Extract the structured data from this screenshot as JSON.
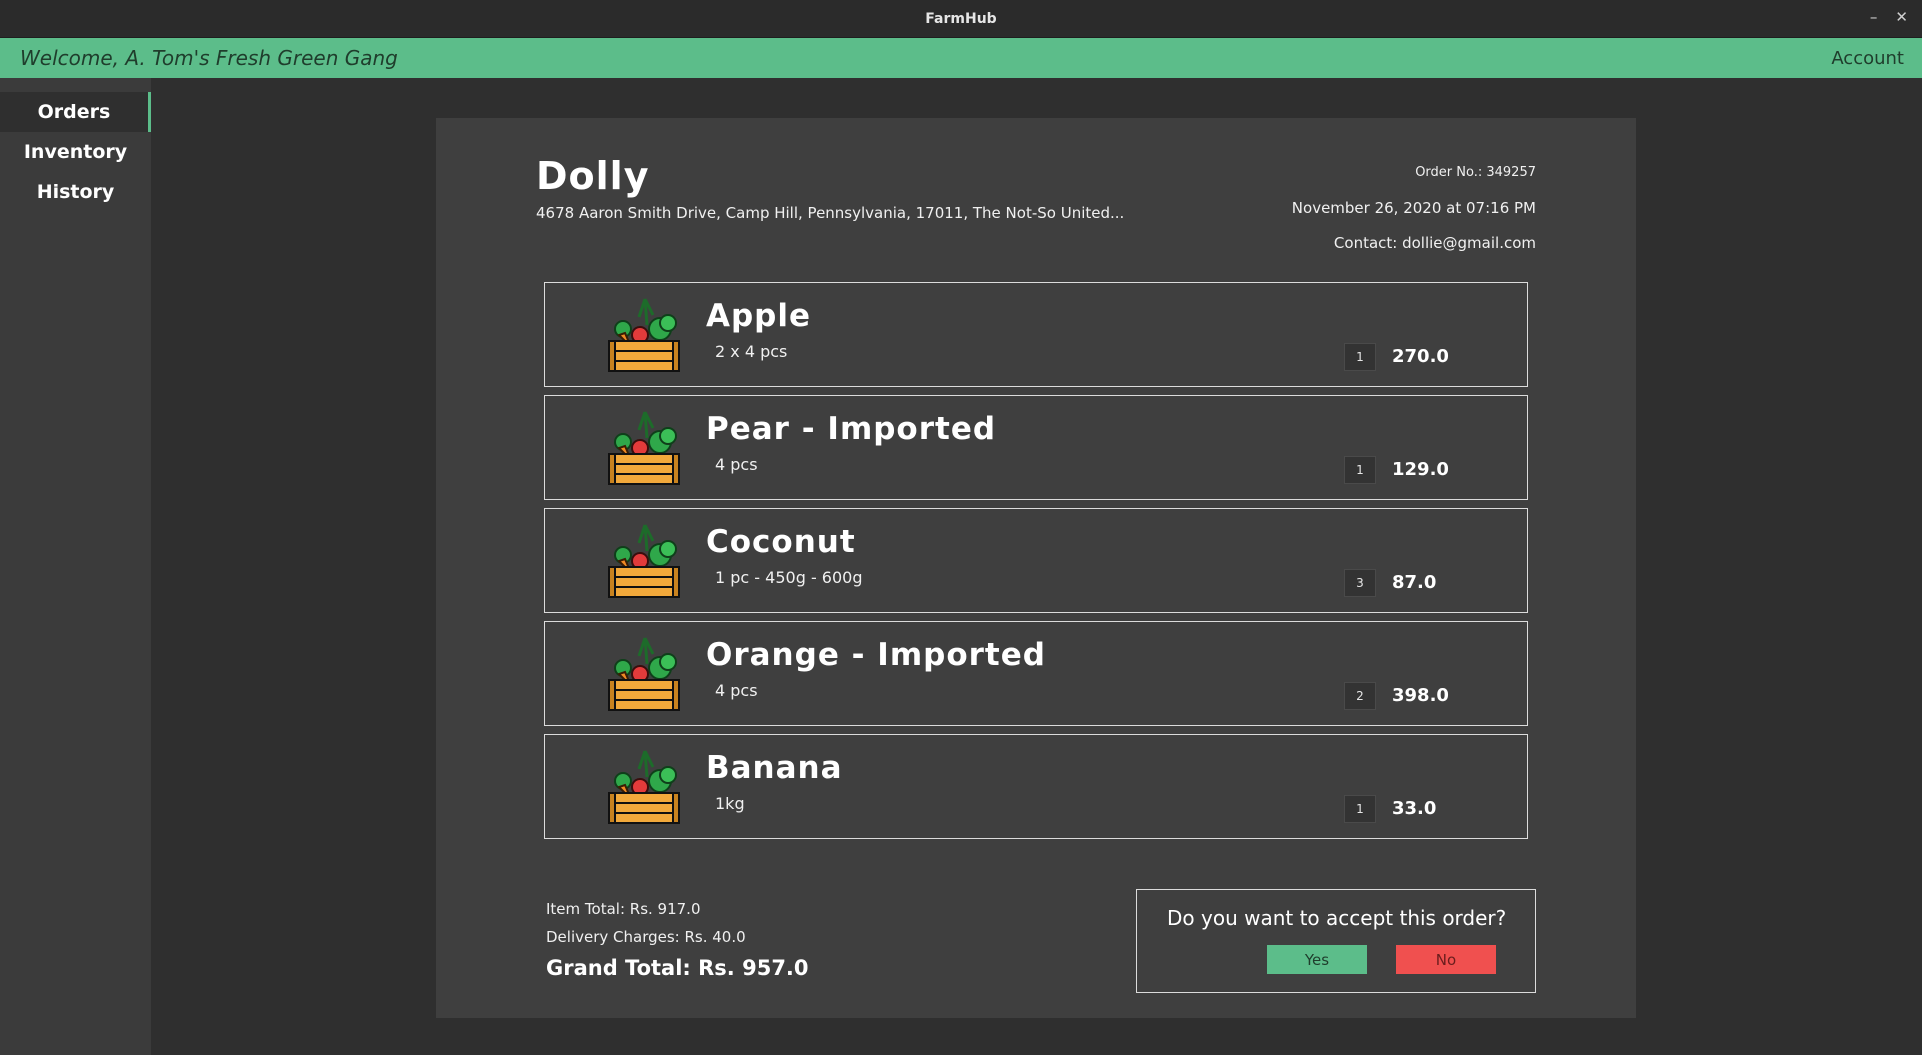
{
  "window": {
    "title": "FarmHub",
    "minimize": "–",
    "close": "✕"
  },
  "header": {
    "welcome": "Welcome, A. Tom's Fresh Green Gang",
    "account": "Account",
    "accent_color": "#5cbd8a"
  },
  "sidebar": {
    "items": [
      {
        "label": "Orders"
      },
      {
        "label": "Inventory"
      },
      {
        "label": "History"
      }
    ]
  },
  "order": {
    "customer": "Dolly",
    "address": "4678  Aaron Smith Drive, Camp Hill, Pennsylvania, 17011, The Not-So United...",
    "order_no": "Order No.: 349257",
    "date": "November 26, 2020 at 07:16 PM",
    "contact": "Contact: dollie@gmail.com",
    "items": [
      {
        "name": "Apple",
        "unit": "2 x 4 pcs",
        "qty": "1",
        "price": "270.0",
        "icon": "vegetable-crate-icon"
      },
      {
        "name": "Pear - Imported",
        "unit": "4 pcs",
        "qty": "1",
        "price": "129.0",
        "icon": "vegetable-crate-icon"
      },
      {
        "name": "Coconut",
        "unit": "1 pc - 450g - 600g",
        "qty": "3",
        "price": "87.0",
        "icon": "vegetable-crate-icon"
      },
      {
        "name": "Orange - Imported",
        "unit": "4 pcs",
        "qty": "2",
        "price": "398.0",
        "icon": "vegetable-crate-icon"
      },
      {
        "name": "Banana",
        "unit": "1kg",
        "qty": "1",
        "price": "33.0",
        "icon": "vegetable-crate-icon"
      }
    ],
    "item_total": "Item Total: Rs. 917.0",
    "delivery": "Delivery Charges: Rs. 40.0",
    "grand_total": "Grand Total: Rs. 957.0"
  },
  "accept": {
    "question": "Do you want to accept this order?",
    "yes": "Yes",
    "no": "No"
  }
}
